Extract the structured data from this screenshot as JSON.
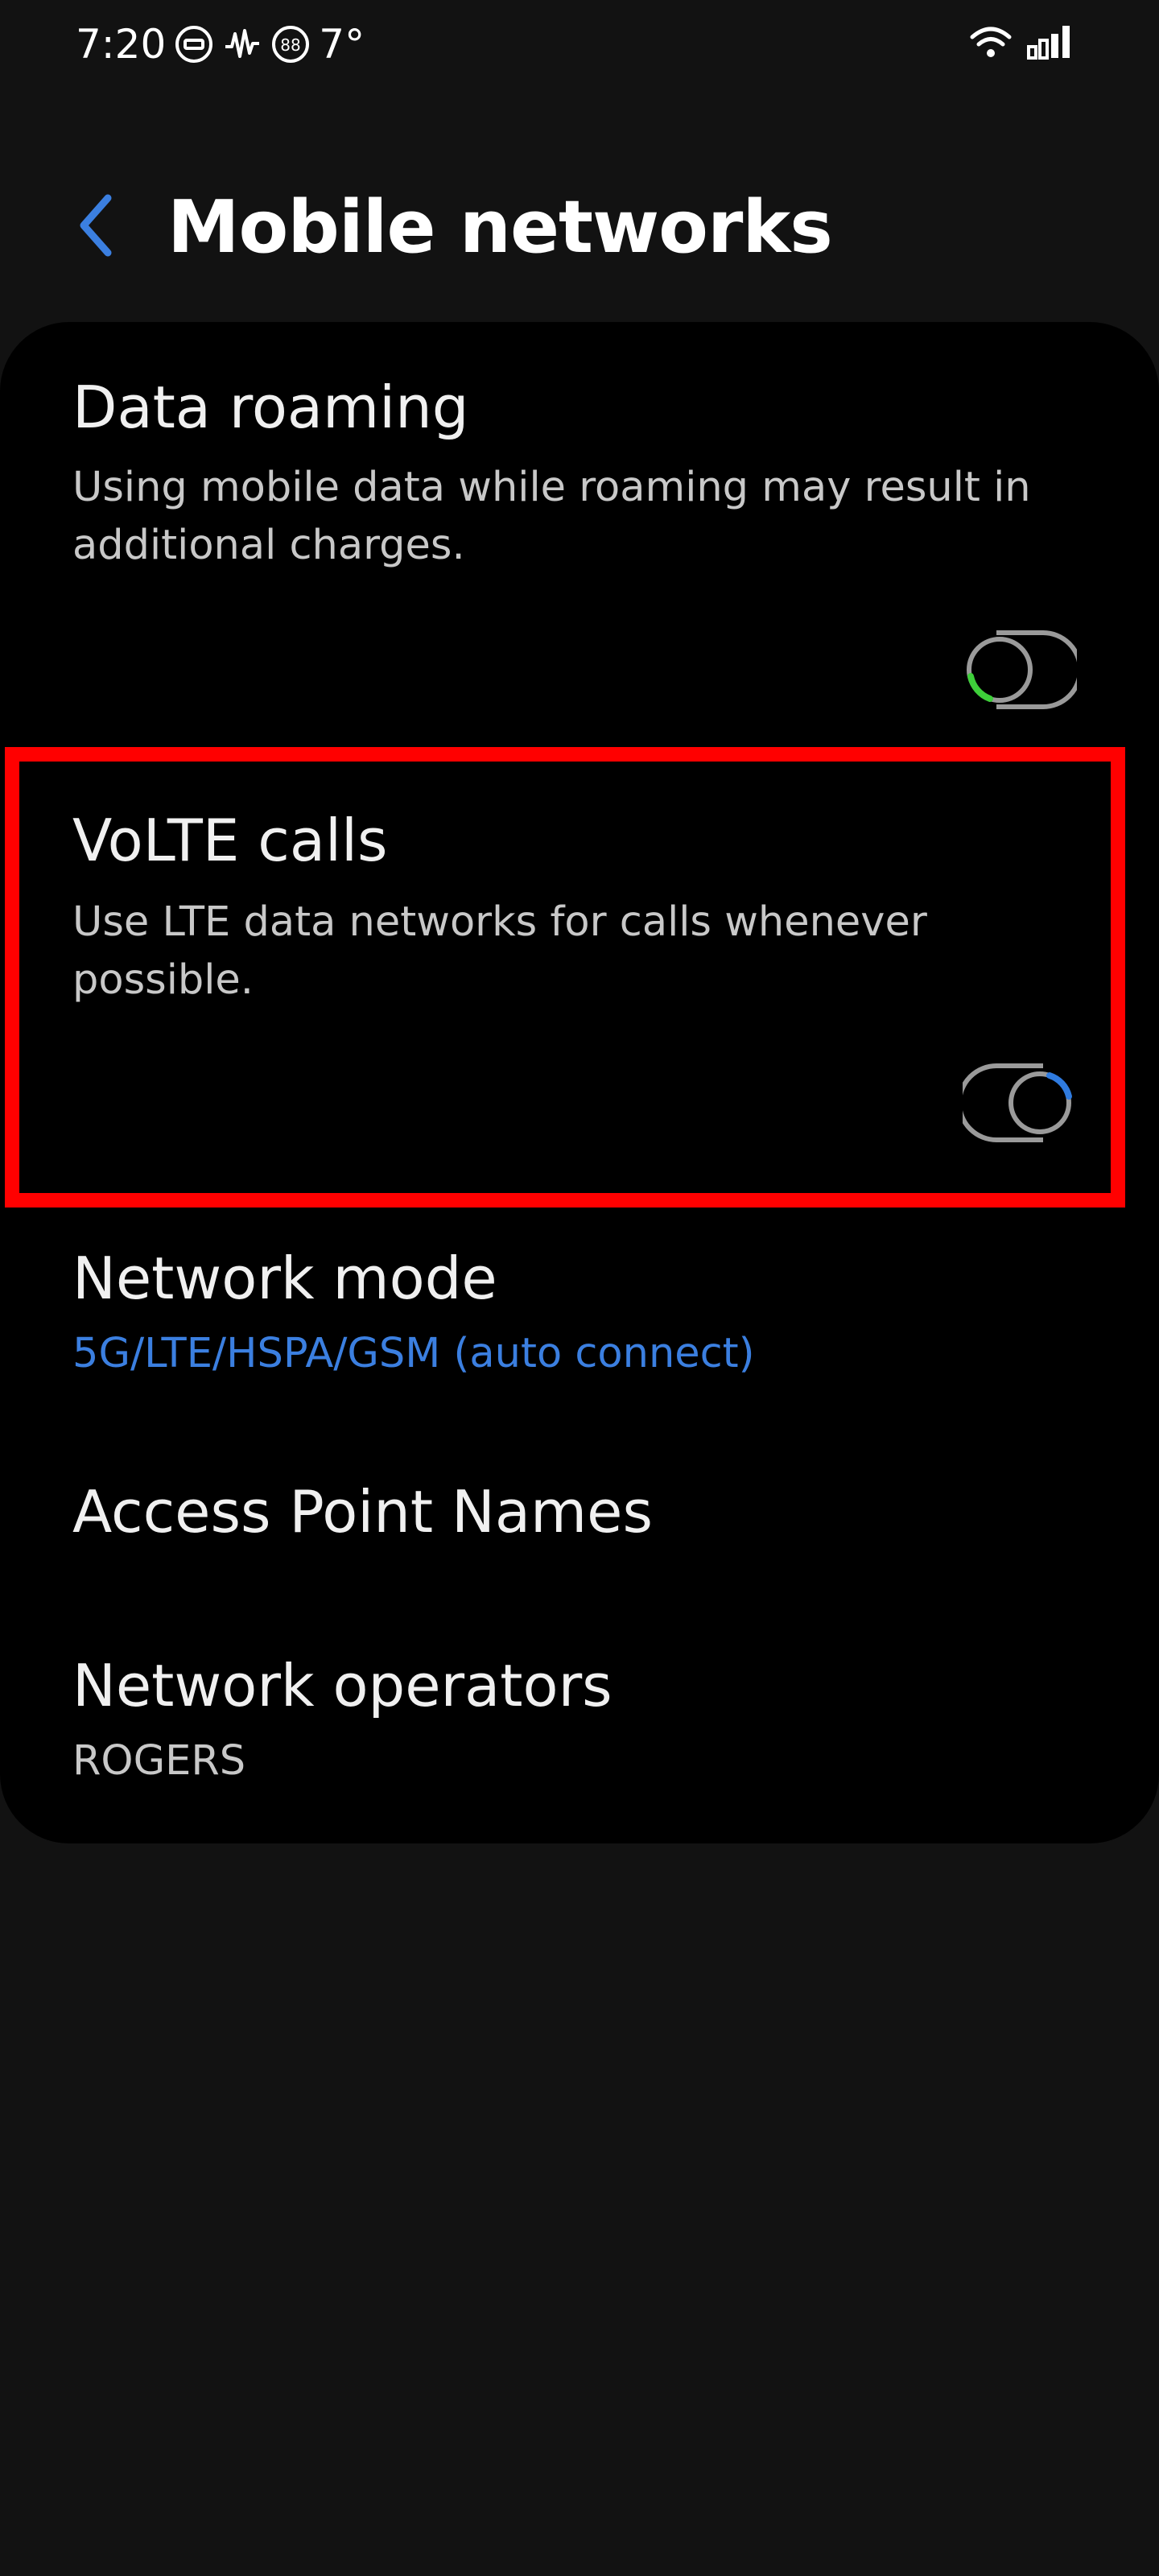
{
  "status_bar": {
    "time": "7:20",
    "temperature": "7°",
    "icons": [
      "message-bubble-icon",
      "activity-wave-icon",
      "notification-88-icon",
      "wifi-icon",
      "cell-signal-icon"
    ]
  },
  "header": {
    "title": "Mobile networks",
    "back_icon": "chevron-left-icon"
  },
  "settings": {
    "data_roaming": {
      "title": "Data roaming",
      "description": "Using mobile data while roaming may result in additional charges.",
      "enabled": false
    },
    "volte_calls": {
      "title": "VoLTE calls",
      "description": "Use LTE data networks for calls whenever possible.",
      "enabled": true
    },
    "network_mode": {
      "title": "Network mode",
      "value": "5G/LTE/HSPA/GSM (auto connect)"
    },
    "access_point_names": {
      "title": "Access Point Names"
    },
    "network_operators": {
      "title": "Network operators",
      "value": "ROGERS"
    }
  },
  "colors": {
    "background": "#121212",
    "card": "#000000",
    "accent": "#3b7fe0",
    "toggle_off_accent": "#3ecf3a",
    "toggle_on_accent": "#2f7be0",
    "highlight": "#ff0000"
  }
}
